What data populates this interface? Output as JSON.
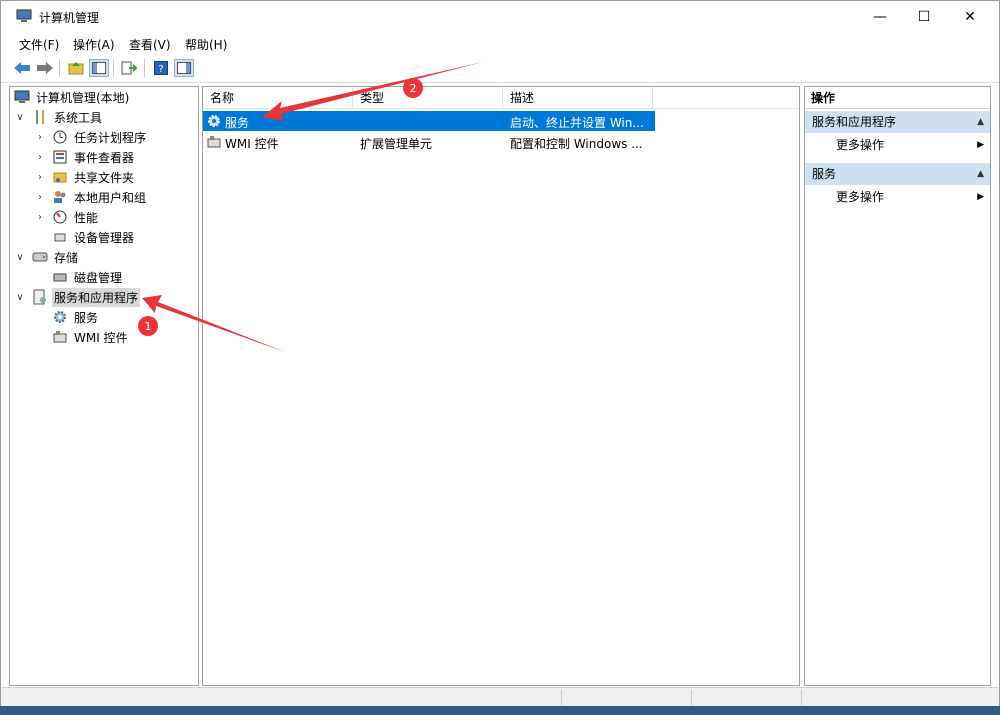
{
  "window": {
    "title": "计算机管理",
    "controls": {
      "minimize": "—",
      "maximize": "☐",
      "close": "✕"
    }
  },
  "menu": [
    "文件(F)",
    "操作(A)",
    "查看(V)",
    "帮助(H)"
  ],
  "tree": {
    "root": "计算机管理(本地)",
    "system_tools": "系统工具",
    "task_scheduler": "任务计划程序",
    "event_viewer": "事件查看器",
    "shared_folders": "共享文件夹",
    "local_users": "本地用户和组",
    "performance": "性能",
    "device_manager": "设备管理器",
    "storage": "存储",
    "disk_management": "磁盘管理",
    "services_apps": "服务和应用程序",
    "services": "服务",
    "wmi": "WMI 控件"
  },
  "list": {
    "columns": [
      "名称",
      "类型",
      "描述"
    ],
    "rows": [
      {
        "name": "服务",
        "type": "",
        "desc": "启动、终止并设置 Win..."
      },
      {
        "name": "WMI 控件",
        "type": "扩展管理单元",
        "desc": "配置和控制 Windows ..."
      }
    ]
  },
  "actions": {
    "title": "操作",
    "sections": [
      {
        "label": "服务和应用程序",
        "item": "更多操作"
      },
      {
        "label": "服务",
        "item": "更多操作"
      }
    ]
  },
  "annotations": {
    "badge1": "1",
    "badge2": "2"
  },
  "colors": {
    "selection": "#0078d7",
    "arrow": "#e8353a",
    "section": "#cfe0f2"
  }
}
